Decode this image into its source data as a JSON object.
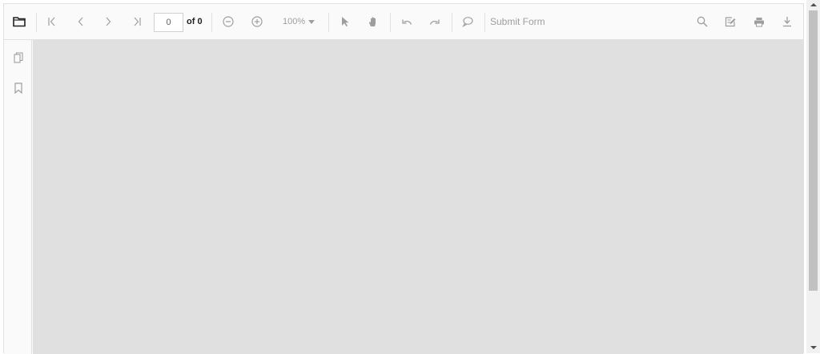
{
  "toolbar": {
    "page_current": "0",
    "page_total_label": "of 0",
    "zoom_level": "100%",
    "submit_form_label": "Submit Form",
    "icons": [
      "open-folder-icon",
      "first-page-icon",
      "previous-page-icon",
      "next-page-icon",
      "last-page-icon",
      "zoom-out-icon",
      "zoom-in-icon",
      "selection-tool-icon",
      "pan-tool-icon",
      "undo-icon",
      "redo-icon",
      "comment-icon",
      "search-icon",
      "annotation-edit-icon",
      "print-icon",
      "download-icon"
    ]
  },
  "navigation_pane": {
    "icons": [
      "page-thumbnails-icon",
      "bookmarks-icon"
    ]
  },
  "colors": {
    "toolbar_bg": "#fafafa",
    "document_bg": "#e0e0e0",
    "icon": "#9e9e9e",
    "scroll_thumb": "#c1c1c1"
  }
}
